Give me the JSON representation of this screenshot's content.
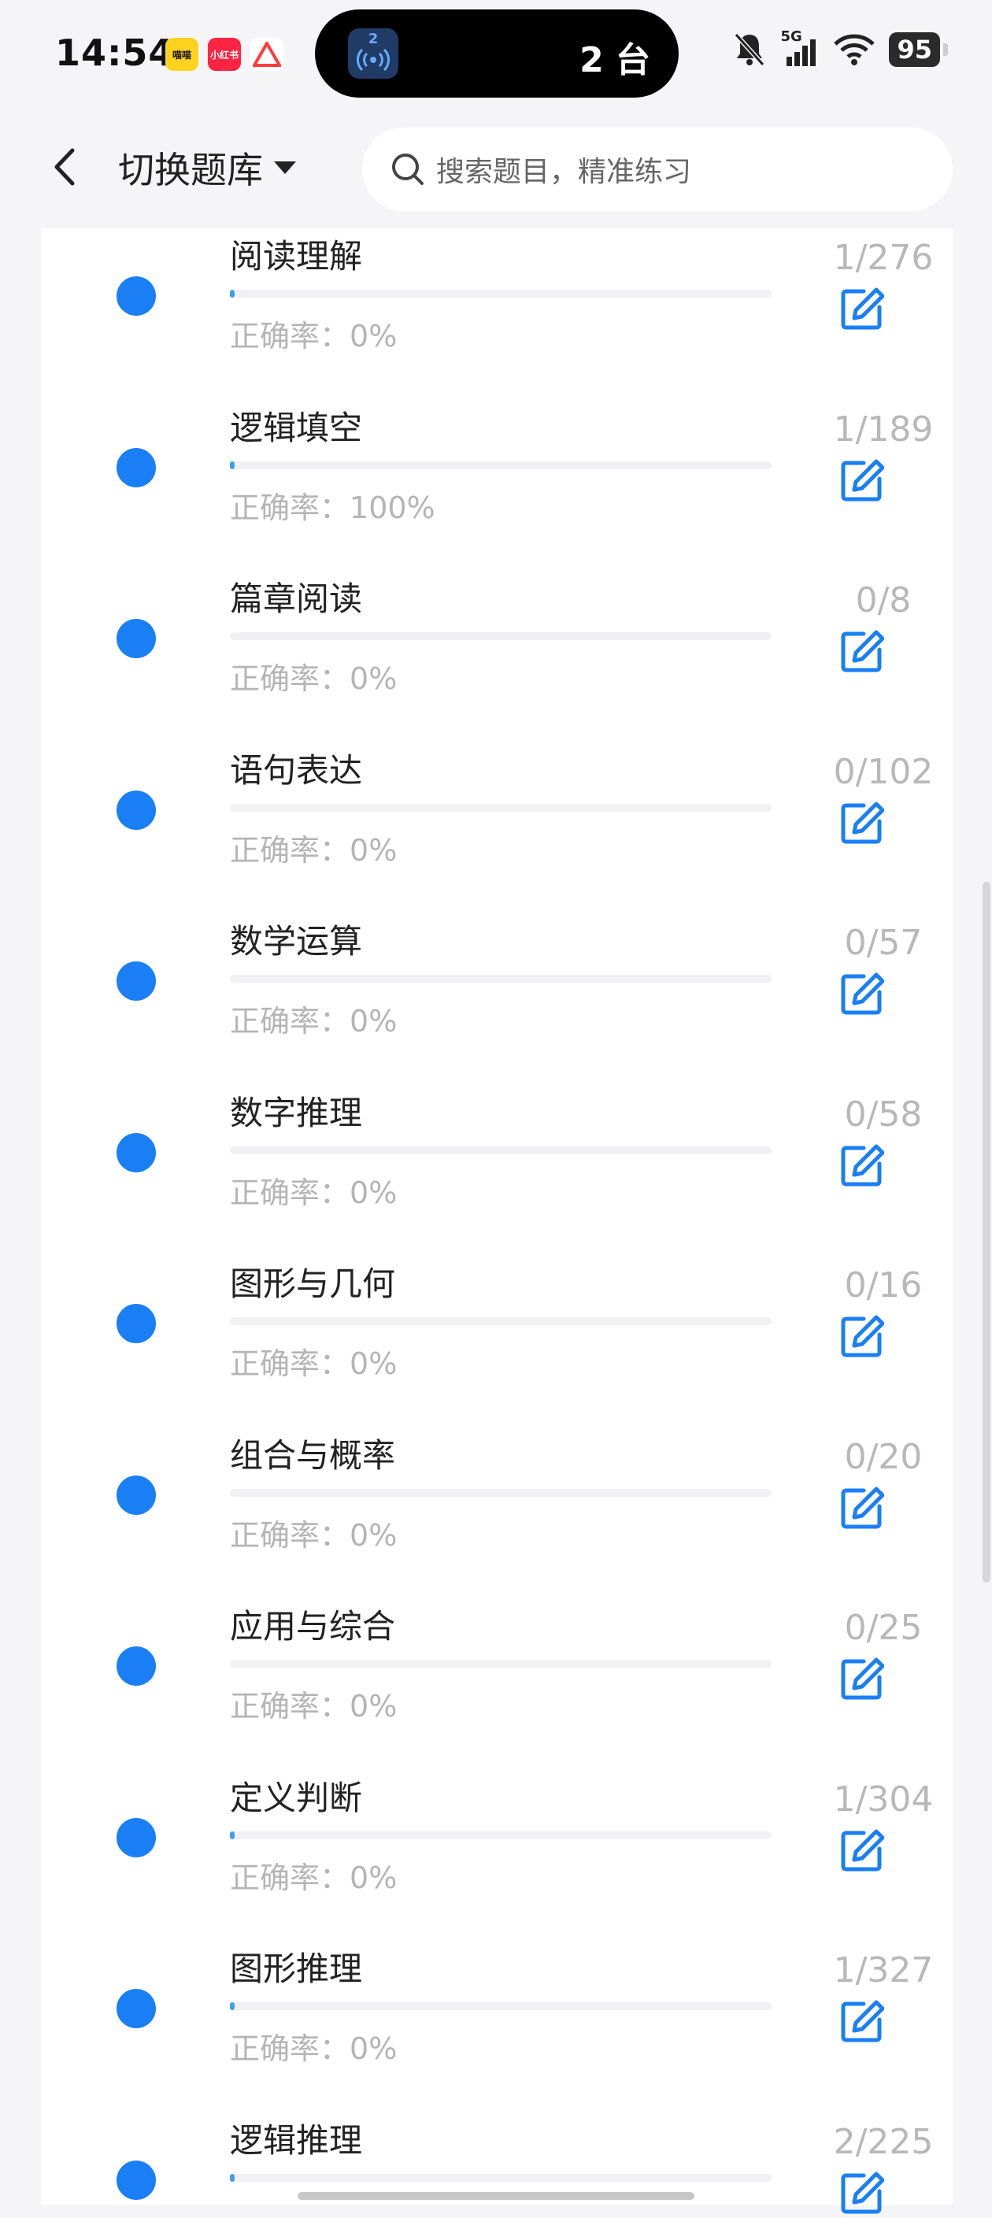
{
  "status": {
    "time": "14:54",
    "app_badges": [
      {
        "label": "喵喵",
        "color": "#ffd21e"
      },
      {
        "label": "小红书",
        "color": "#ff2442"
      },
      {
        "label": "",
        "color": "#ffffff"
      }
    ],
    "pill_number": "2",
    "pill_text": "2 台",
    "network": "5G",
    "battery": "95"
  },
  "header": {
    "switch_label": "切换题库",
    "search_placeholder": "搜索题目，精准练习"
  },
  "accuracy_prefix": "正确率：",
  "items": [
    {
      "title": "阅读理解",
      "accuracy": "0%",
      "count": "1/276",
      "progress": 0.0036
    },
    {
      "title": "逻辑填空",
      "accuracy": "100%",
      "count": "1/189",
      "progress": 0.0053
    },
    {
      "title": "篇章阅读",
      "accuracy": "0%",
      "count": "0/8",
      "progress": 0
    },
    {
      "title": "语句表达",
      "accuracy": "0%",
      "count": "0/102",
      "progress": 0
    },
    {
      "title": "数学运算",
      "accuracy": "0%",
      "count": "0/57",
      "progress": 0
    },
    {
      "title": "数字推理",
      "accuracy": "0%",
      "count": "0/58",
      "progress": 0
    },
    {
      "title": "图形与几何",
      "accuracy": "0%",
      "count": "0/16",
      "progress": 0
    },
    {
      "title": "组合与概率",
      "accuracy": "0%",
      "count": "0/20",
      "progress": 0
    },
    {
      "title": "应用与综合",
      "accuracy": "0%",
      "count": "0/25",
      "progress": 0
    },
    {
      "title": "定义判断",
      "accuracy": "0%",
      "count": "1/304",
      "progress": 0.0033
    },
    {
      "title": "图形推理",
      "accuracy": "0%",
      "count": "1/327",
      "progress": 0.0031
    },
    {
      "title": "逻辑推理",
      "accuracy": "",
      "count": "2/225",
      "progress": 0.0089
    }
  ]
}
